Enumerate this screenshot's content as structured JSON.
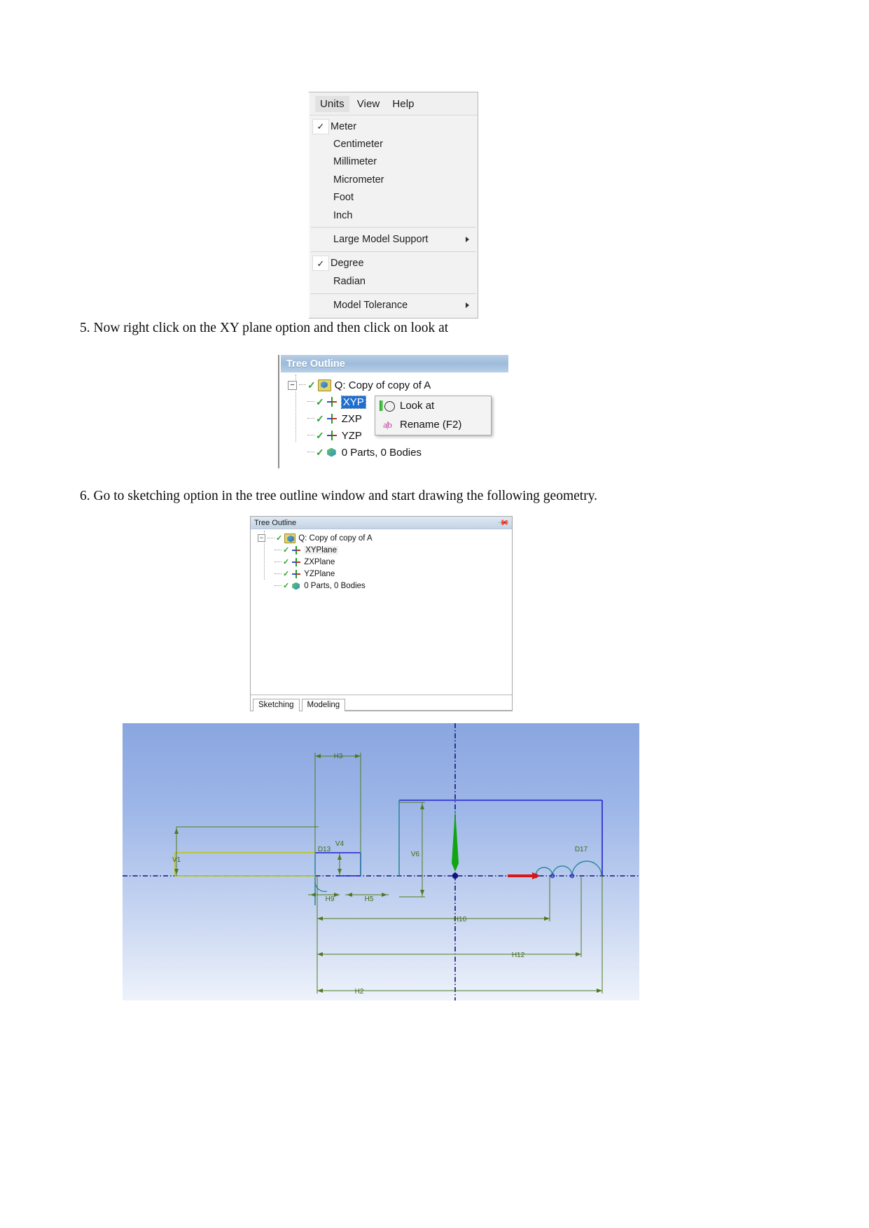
{
  "document": {
    "step5": "5. Now right click on the XY plane option and then click on look at",
    "step6": "6. Go to sketching option in the tree outline window and start drawing the following geometry."
  },
  "units_menu": {
    "menubar": [
      {
        "label": "Units",
        "active": true
      },
      {
        "label": "View",
        "active": false
      },
      {
        "label": "Help",
        "active": false
      }
    ],
    "items": [
      {
        "label": "Meter",
        "checked": true,
        "submenu": false
      },
      {
        "label": "Centimeter",
        "checked": false,
        "submenu": false
      },
      {
        "label": "Millimeter",
        "checked": false,
        "submenu": false
      },
      {
        "label": "Micrometer",
        "checked": false,
        "submenu": false
      },
      {
        "label": "Foot",
        "checked": false,
        "submenu": false
      },
      {
        "label": "Inch",
        "checked": false,
        "submenu": false
      },
      {
        "label": "Large Model Support",
        "checked": false,
        "submenu": true
      },
      {
        "label": "Degree",
        "checked": true,
        "submenu": false
      },
      {
        "label": "Radian",
        "checked": false,
        "submenu": false
      },
      {
        "label": "Model Tolerance",
        "checked": false,
        "submenu": true
      }
    ],
    "checkmark": "✓"
  },
  "tree_with_context": {
    "title": "Tree Outline",
    "expander": "−",
    "root": "Q: Copy of copy of A",
    "nodes": [
      {
        "label": "XYP",
        "selected": true
      },
      {
        "label": "ZXP",
        "selected": false
      },
      {
        "label": "YZP",
        "selected": false
      },
      {
        "label": "0 Parts, 0 Bodies",
        "selected": false
      }
    ],
    "context_menu": [
      {
        "label": "Look at",
        "icon": "look-at-icon"
      },
      {
        "label": "Rename (F2)",
        "icon": "rename-icon"
      }
    ]
  },
  "tree_panel": {
    "title": "Tree Outline",
    "pin_glyph": "📌",
    "expander": "−",
    "root": "Q: Copy of copy of A",
    "nodes": [
      {
        "label": "XYPlane",
        "highlighted": true
      },
      {
        "label": "ZXPlane",
        "highlighted": false
      },
      {
        "label": "YZPlane",
        "highlighted": false
      },
      {
        "label": "0 Parts, 0 Bodies",
        "highlighted": false
      }
    ],
    "tabs": [
      {
        "label": "Sketching",
        "active": true
      },
      {
        "label": "Modeling",
        "active": false
      }
    ]
  },
  "sketch": {
    "dimension_labels": [
      "H3",
      "V1",
      "V4",
      "V6",
      "D13",
      "D17",
      "H9",
      "H5",
      "H10",
      "H12",
      "H2"
    ],
    "colors": {
      "background_top": "#8aa6e0",
      "background_bottom": "#eef2fb",
      "dimension_green": "#4f7a1f",
      "geometry_blue": "#2222cc",
      "constrained_teal": "#2e8a9e",
      "unconstrained_olive": "#b9c41f",
      "axis_dotted": "#1a1a6e",
      "origin_dot": "#1a1a6e",
      "arrow_red": "#d81616",
      "arrow_green": "#12a512"
    }
  }
}
